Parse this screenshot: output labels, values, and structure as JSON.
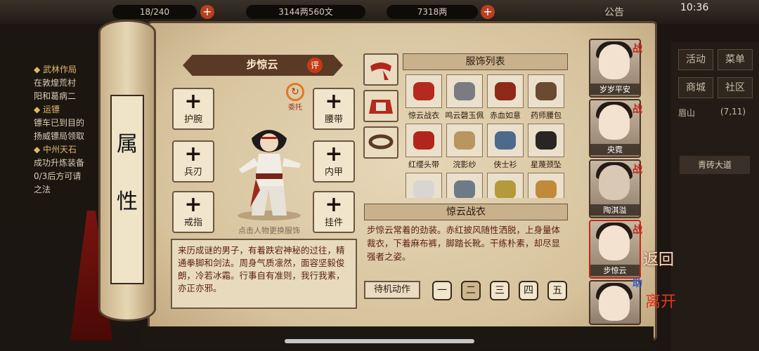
{
  "topbar": {
    "bag": "18/240",
    "copper": "3144两560文",
    "silver": "7318两",
    "notice": "公告",
    "time": "10:36"
  },
  "quests": [
    {
      "title": "◆ 武林作局",
      "lines": [
        "在敦煌荒村",
        "阳和葛病二"
      ]
    },
    {
      "title": "◆ 运镖",
      "lines": [
        "镖车已到目的",
        "扬威镖局领取"
      ]
    },
    {
      "title": "◆ 中州天石",
      "lines": [
        "成功升炼装备",
        "0/3后方可请",
        "之法"
      ]
    }
  ],
  "right_menu": {
    "buttons": [
      "活动",
      "菜单",
      "商城",
      "社区"
    ],
    "location": "眉山",
    "coords": "(7,11)",
    "road": "青砖大道"
  },
  "scroll_title": [
    "属",
    "性"
  ],
  "character": {
    "name": "步惊云",
    "review_badge": "评",
    "consign_label": "委托",
    "slots_left": [
      "护腕",
      "兵刃",
      "戒指"
    ],
    "slots_right": [
      "腰带",
      "内甲",
      "挂件"
    ],
    "plus": "+",
    "change_hint": "点击人物更换服饰",
    "description": "来历成谜的男子，有着跌宕神秘的过往，精通拳脚和剑法。周身气质凛然，面容坚毅俊朗，冷若冰霜。行事自有准则，我行我素，亦正亦邪。"
  },
  "clothing": {
    "list_title": "服饰列表",
    "items": [
      {
        "name": "惊云战衣",
        "color": "#b42a1c"
      },
      {
        "name": "鸣云磬玉佩",
        "color": "#7c7b82"
      },
      {
        "name": "赤血如意",
        "color": "#8f2a18"
      },
      {
        "name": "药师腰包",
        "color": "#6a4a30"
      },
      {
        "name": "红缨头带",
        "color": "#b3251c"
      },
      {
        "name": "浣影纱",
        "color": "#b9955f"
      },
      {
        "name": "侠士衫",
        "color": "#4d6a8c"
      },
      {
        "name": "星蔑颈坠",
        "color": "#2a2522"
      },
      {
        "name": "",
        "color": "#d8d6d2"
      },
      {
        "name": "",
        "color": "#6f7a88"
      },
      {
        "name": "",
        "color": "#b49a3c"
      },
      {
        "name": "",
        "color": "#c08a3a"
      }
    ],
    "selected_name": "惊云战衣",
    "selected_desc": "步惊云常着的劲装。赤红披风随性洒脱，上身量体裁衣，下着麻布裤，脚踏长靴。干练朴素，却尽显强者之姿。",
    "idle_label": "待机动作",
    "poses": [
      "一",
      "二",
      "三",
      "四",
      "五"
    ],
    "selected_pose": 1
  },
  "roster": [
    {
      "name": "岁岁平安",
      "tag": "战"
    },
    {
      "name": "央霓",
      "tag": "战"
    },
    {
      "name": "陶淇溢",
      "tag": "战"
    },
    {
      "name": "步惊云",
      "tag": "战"
    },
    {
      "name": "",
      "tag": "助"
    }
  ],
  "actions": {
    "back": "返回",
    "leave": "离开"
  }
}
